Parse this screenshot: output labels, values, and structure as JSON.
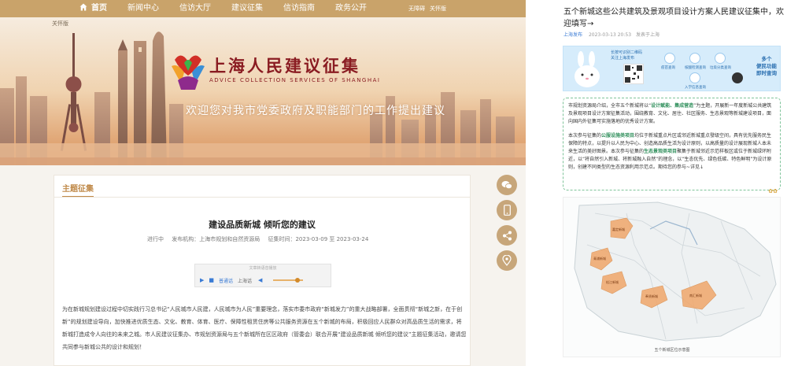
{
  "nav": {
    "items": [
      {
        "label": "首页"
      },
      {
        "label": "新闻中心"
      },
      {
        "label": "信访大厅"
      },
      {
        "label": "建议征集"
      },
      {
        "label": "信访指南"
      },
      {
        "label": "政务公开"
      }
    ],
    "mini": [
      "无障碍",
      "关怀版"
    ]
  },
  "hero": {
    "care_mode": "关怀版",
    "logo_title": "上海人民建议征集",
    "logo_subtitle": "ADVICE COLLECTION SERVICES OF SHANGHAI",
    "slogan": "欢迎您对我市党委政府及职能部门的工作提出建议"
  },
  "section": {
    "tag": "主题征集",
    "article_title": "建设品质新城 倾听您的建议",
    "status": "进行中",
    "publisher": "发布机构：上海市规划和自然资源局",
    "period": "征集时间：2023-03-09 至 2023-03-24",
    "audio_caption": "文章转语音播放",
    "audio_voice": "普通话",
    "audio_lang": "上海话",
    "body": "为在新城规划建设过程中切实践行习总书记“人民城市人民建，人民城市为人民”重要理念，落实市委市政府“新城发力”的重大战略部署，全面贯彻“新城之新，在于创新”的规划建设导向，加快推进优质生态、文化、教育、体育、医疗、保障性租赁住房等公共服务资源在五个新城的布局，积极回应人民群众对高品质生活的需求，将新城打造成令人向往的未来之城。市人民建议征集办、市规划资源局与五个新城所在区区政府（管委会）联合开展“建设品质新城 倾听您的建议”主题征集活动，邀请您共同参与新城公共的设计和规划！"
  },
  "side_buttons": [
    "wechat-icon",
    "mobile-icon",
    "share-icon",
    "location-icon"
  ],
  "right": {
    "title": "五个新城这些公共建筑及景观项目设计方案人民建议征集中，欢迎填写→",
    "source": "上海发布",
    "date": "2023-03-13 20:53",
    "place": "发表于上海",
    "banner": {
      "qr_caption_1": "长按可识别二维码",
      "qr_caption_2": "关注上海发布",
      "services": [
        "疫苗查询",
        "核酸检测查询",
        "入学信息查询",
        "垃圾分类查询"
      ],
      "more_1": "多个",
      "more_2": "便民功能",
      "more_3": "即时查询"
    },
    "notice_p1_a": "市规划资源局介绍，全市五个新城将以“",
    "notice_p1_hl": "设计赋能、集成营造",
    "notice_p1_b": "”为主题，开展新一年度新城公共建筑及景观项目设计方案征集活动，围绕教育、文化、居住、社区服务、生态景观等新城建设项目，面向国内外征集可实施落地的优秀设计方案。",
    "notice_p2_a": "本次参与征集的",
    "notice_p2_hl1": "公服设施类项目",
    "notice_p2_b": "均位于新城重点片区或邻近新城重点發级空间，具有优先服务民生保障的特点，以提升以人民为中心、创造高品质生活为设计原则，以高质量的设计展现新城人本未来生活的美好图景。本次参与征集的",
    "notice_p2_hl2": "生态景观类项目",
    "notice_p2_c": "聚集于新城邻近示范样板区或位于新城绿环附近，以“将自然引入新城、将新城融入自然”的理念，以“生态优先、绿色低碳、特色鲜明”为设计原则，创建不同类型的生态资源利用示范点。期待您的参与~详见↓",
    "map_caption": "五个新城区位示意图",
    "map_labels": [
      "嘉定新城",
      "青浦新城",
      "松江新城",
      "奉贤新城",
      "南汇新城"
    ]
  }
}
